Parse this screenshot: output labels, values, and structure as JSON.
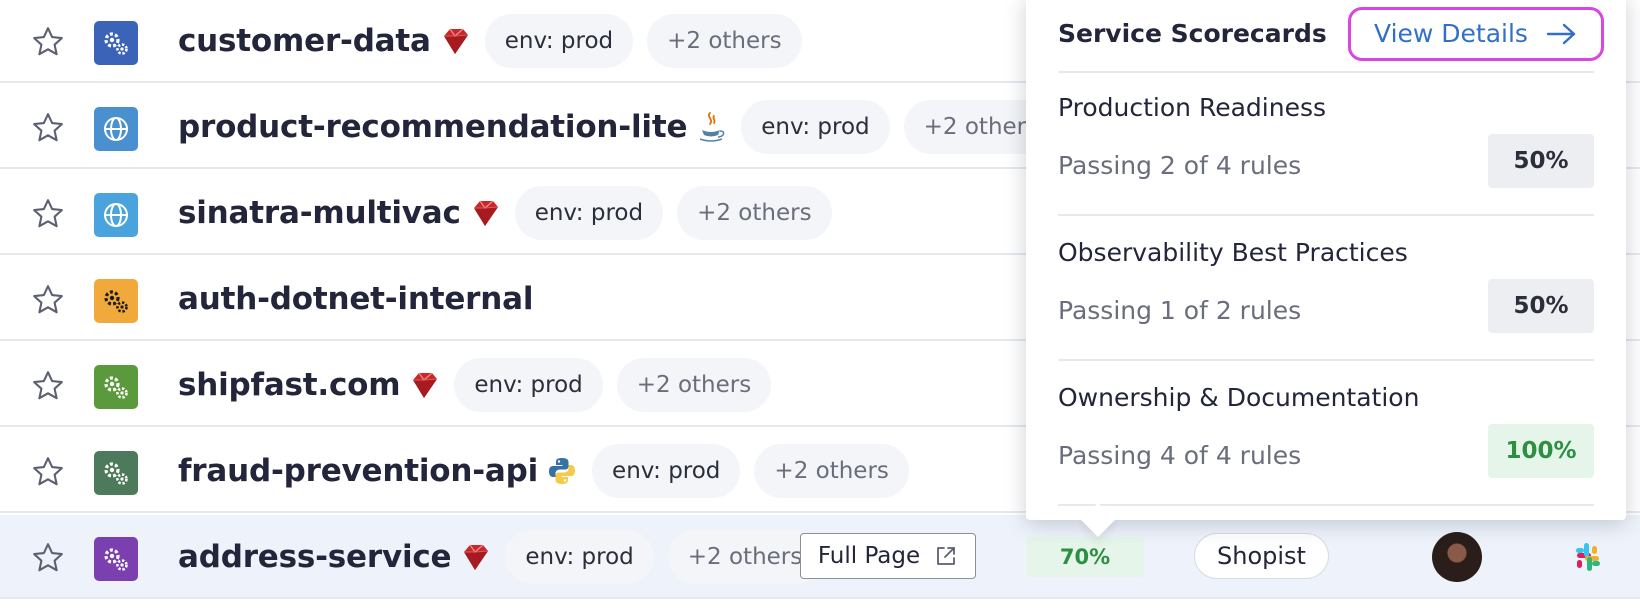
{
  "services": [
    {
      "name": "customer-data",
      "lang": "ruby-icon",
      "icon": "gears-icon",
      "icon_color": "#3b63b8",
      "tags": [
        "env: prod",
        "+2 others"
      ]
    },
    {
      "name": "product-recommendation-lite",
      "lang": "java-icon",
      "icon": "globe-icon",
      "icon_color": "#4a8fd0",
      "tags": [
        "env: prod",
        "+2 others"
      ]
    },
    {
      "name": "sinatra-multivac",
      "lang": "ruby-icon",
      "icon": "globe-icon",
      "icon_color": "#4aa3dc",
      "tags": [
        "env: prod",
        "+2 others"
      ]
    },
    {
      "name": "auth-dotnet-internal",
      "lang": "",
      "icon": "gears-icon",
      "icon_color": "#f2a93b",
      "tags": []
    },
    {
      "name": "shipfast.com",
      "lang": "ruby-icon",
      "icon": "gears-icon",
      "icon_color": "#5a9a3c",
      "tags": [
        "env: prod",
        "+2 others"
      ]
    },
    {
      "name": "fraud-prevention-api",
      "lang": "python-icon",
      "icon": "gears-icon",
      "icon_color": "#4c7a5a",
      "tags": [
        "env: prod",
        "+2 others"
      ]
    },
    {
      "name": "address-service",
      "lang": "ruby-icon",
      "icon": "gears-icon",
      "icon_color": "#7b3fb0",
      "tags": [
        "env: prod",
        "+2 others"
      ]
    }
  ],
  "selected_row": {
    "full_page_label": "Full Page",
    "score": "70%",
    "team": "Shopist"
  },
  "popover": {
    "title": "Service Scorecards",
    "view_details": "View Details",
    "scorecards": [
      {
        "name": "Production Readiness",
        "passing": "Passing 2 of 4 rules",
        "pct": "50%"
      },
      {
        "name": "Observability Best Practices",
        "passing": "Passing 1 of 2 rules",
        "pct": "50%"
      },
      {
        "name": "Ownership & Documentation",
        "passing": "Passing 4 of 4 rules",
        "pct": "100%"
      }
    ]
  },
  "colors": {
    "accent_link": "#3270c8",
    "highlight_ring": "#d946e0",
    "pass_green": "#2e8f43",
    "row_selected": "#eef3fb"
  }
}
